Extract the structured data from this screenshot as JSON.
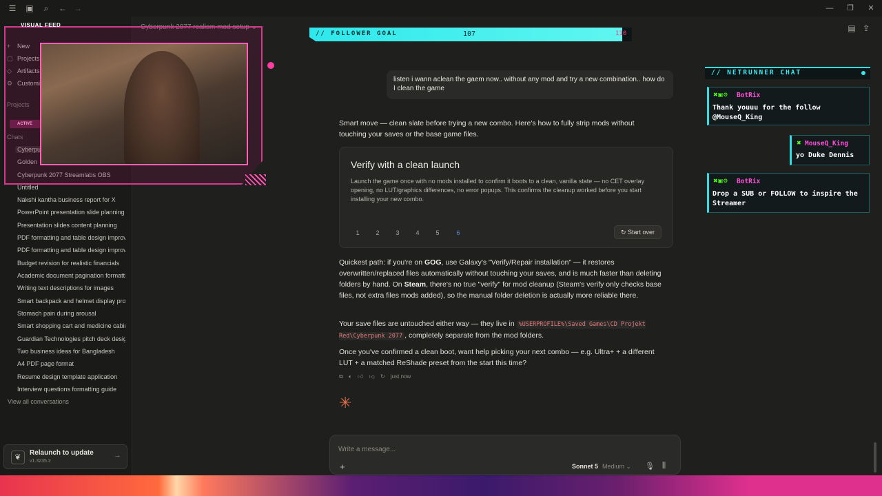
{
  "window": {
    "conversation_title": "Cyberpunk 2077 realism mod setup",
    "chevron_icon": "chevron-down-icon"
  },
  "sidebar": {
    "top_items": [
      {
        "label": "New",
        "icon": "plus-icon"
      },
      {
        "label": "Projects",
        "icon": "folder-icon"
      },
      {
        "label": "Artifacts",
        "icon": "artifact-icon"
      },
      {
        "label": "Customize",
        "icon": "customize-icon"
      }
    ],
    "projects_heading": "Projects",
    "chats_heading": "Chats",
    "chats": [
      "Cyberpunk 2077 realism mod setup",
      "Golden",
      "Cyberpunk 2077 Streamlabs OBS",
      "Untitled",
      "Nakshi kantha business report for X",
      "PowerPoint presentation slide planning",
      "Presentation slides content planning",
      "PDF formatting and table design improvements",
      "PDF formatting and table design improvements",
      "Budget revision for realistic financials",
      "Academic document pagination formatting",
      "Writing text descriptions for images",
      "Smart backpack and helmet display prototype",
      "Stomach pain during arousal",
      "Smart shopping cart and medicine cabinet",
      "Guardian Technologies pitch deck design",
      "Two business ideas for Bangladesh",
      "A4 PDF page format",
      "Resume design template application",
      "Interview questions formatting guide"
    ],
    "view_all": "View all conversations",
    "relaunch": {
      "title": "Relaunch to update",
      "version": "v1.3235.2"
    }
  },
  "webcam": {
    "label": "VISUAL FEED",
    "status": "ACTIVE"
  },
  "follower_goal": {
    "label": "// FOLLOWER GOAL",
    "count": "107",
    "target": "110",
    "progress": 0.97
  },
  "chat": {
    "user_message": "listen i wann aclean the gaem now.. without any mod and try a new combination.. how do I clean the game",
    "intro": "Smart move — clean slate before trying a new combo. Here's how to fully strip mods without touching your saves or the base game files.",
    "card": {
      "title": "Verify with a clean launch",
      "body": "Launch the game once with no mods installed to confirm it boots to a clean, vanilla state — no CET overlay opening, no LUT/graphics differences, no error popups. This confirms the cleanup worked before you start installing your new combo.",
      "steps": [
        "1",
        "2",
        "3",
        "4",
        "5",
        "6"
      ],
      "active_step": "6",
      "start_over": "Start over"
    },
    "para1_a": "Quickest path: if you're on ",
    "para1_gog": "GOG",
    "para1_b": ", use Galaxy's \"Verify/Repair installation\" — it restores overwritten/replaced files automatically without touching your saves, and is much faster than deleting folders by hand. On ",
    "para1_steam": "Steam",
    "para1_c": ", there's no true \"verify\" for mod cleanup (Steam's verify only checks base files, not extra files mods added), so the manual folder deletion is actually more reliable there.",
    "para2_a": "Your save files are untouched either way — they live in ",
    "para2_code": "%USERPROFILE%\\Saved Games\\CD Projekt Red\\Cyberpunk 2077",
    "para2_b": ", completely separate from the mod folders.",
    "para3": "Once you've confirmed a clean boot, want help picking your next combo — e.g. Ultra+ + a different LUT + a matched ReShade preset from the start this time?",
    "timestamp": "just now"
  },
  "composer": {
    "placeholder": "Write a message...",
    "model": "Sonnet 5",
    "effort": "Medium"
  },
  "netrunner": {
    "title": "// NETRUNNER CHAT",
    "messages": [
      {
        "user": "BotRix",
        "text": "Thank youuu for the follow @MouseQ_King"
      },
      {
        "user": "MouseQ_King",
        "text": "yo Duke Dennis"
      },
      {
        "user": "BotRix",
        "text": "Drop a SUB or FOLLOW to inspire the Streamer"
      }
    ]
  },
  "colors": {
    "accent_cyan": "#2de0e6",
    "accent_pink": "#ff4fd8",
    "claude_orange": "#e0714a"
  }
}
